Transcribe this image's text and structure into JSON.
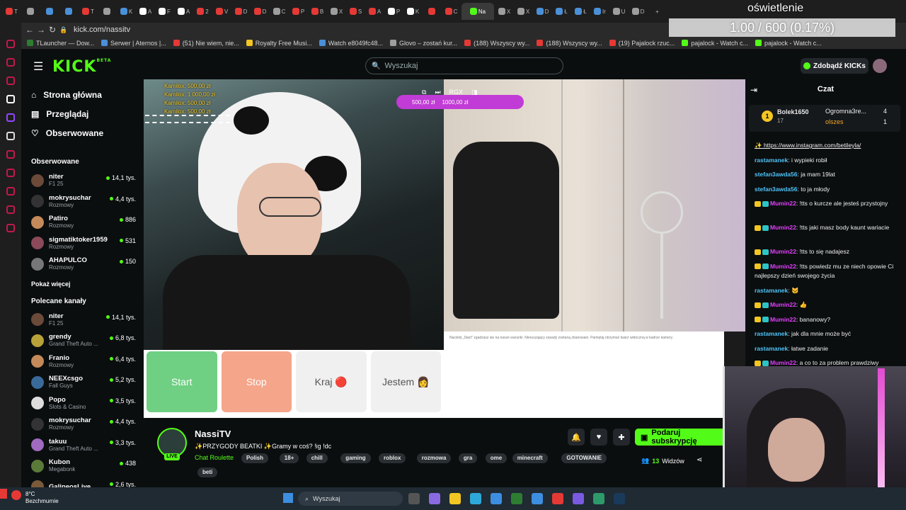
{
  "browser": {
    "tabs": [
      {
        "label": "T",
        "color": "#e53935"
      },
      {
        "label": "",
        "color": "#9e9e9e"
      },
      {
        "label": "",
        "color": "#4a90d9"
      },
      {
        "label": "",
        "color": "#4a90d9"
      },
      {
        "label": "T",
        "color": "#e53935"
      },
      {
        "label": "",
        "color": "#9e9e9e"
      },
      {
        "label": "K",
        "color": "#4a90d9"
      },
      {
        "label": "A",
        "color": "#fff"
      },
      {
        "label": "F",
        "color": "#fff"
      },
      {
        "label": "A",
        "color": "#fff"
      },
      {
        "label": "2",
        "color": "#e53935"
      },
      {
        "label": "V",
        "color": "#e53935"
      },
      {
        "label": "D",
        "color": "#e53935"
      },
      {
        "label": "D",
        "color": "#e53935"
      },
      {
        "label": "C",
        "color": "#9e9e9e"
      },
      {
        "label": "P",
        "color": "#e53935"
      },
      {
        "label": "B",
        "color": "#e53935"
      },
      {
        "label": "X",
        "color": "#9e9e9e"
      },
      {
        "label": "S",
        "color": "#e53935"
      },
      {
        "label": "A",
        "color": "#e53935"
      },
      {
        "label": "P",
        "color": "#fff"
      },
      {
        "label": "K",
        "color": "#fff"
      },
      {
        "label": "",
        "color": "#e53935"
      },
      {
        "label": "C",
        "color": "#e53935"
      },
      {
        "label": "Na",
        "color": "#53fc18",
        "active": true
      },
      {
        "label": "X",
        "color": "#9e9e9e"
      },
      {
        "label": "X",
        "color": "#9e9e9e"
      },
      {
        "label": "D",
        "color": "#4a90d9"
      },
      {
        "label": "Ł",
        "color": "#4a90d9"
      },
      {
        "label": "Ł",
        "color": "#4a90d9"
      },
      {
        "label": "Ir",
        "color": "#4a90d9"
      },
      {
        "label": "U",
        "color": "#9e9e9e"
      },
      {
        "label": "D",
        "color": "#9e9e9e"
      }
    ],
    "url": "kick.com/nassitv",
    "bookmarks": [
      {
        "label": "TLauncher — Dow...",
        "color": "#2e7d32"
      },
      {
        "label": "Serwer | Aternos |...",
        "color": "#4a90d9"
      },
      {
        "label": "(51) Nie wiem, nie...",
        "color": "#e53935"
      },
      {
        "label": "Royalty Free Musi...",
        "color": "#f3c623"
      },
      {
        "label": "Watch e8049fc48...",
        "color": "#4a90d9"
      },
      {
        "label": "Glovo – zostań kur...",
        "color": "#9e9e9e"
      },
      {
        "label": "(188) Wszyscy wy...",
        "color": "#e53935"
      },
      {
        "label": "(188) Wszyscy wy...",
        "color": "#e53935"
      },
      {
        "label": "(19) Pajalock rzuc...",
        "color": "#e53935"
      },
      {
        "label": "pajalock - Watch c...",
        "color": "#53fc18"
      },
      {
        "label": "pajalock - Watch c...",
        "color": "#53fc18"
      }
    ]
  },
  "header": {
    "logo": "KICK",
    "logo_sup": "BETA",
    "search_placeholder": "Wyszukaj",
    "get_kicks": "Zdobądź KICKs"
  },
  "sidebar": {
    "nav": [
      {
        "label": "Strona główna",
        "icon": "home-icon"
      },
      {
        "label": "Przeglądaj",
        "icon": "browse-icon"
      },
      {
        "label": "Obserwowane",
        "icon": "heart-icon"
      }
    ],
    "following_title": "Obserwowane",
    "following": [
      {
        "name": "niter",
        "category": "F1 25",
        "viewers": "14,1 tys.",
        "color": "#6b4a3a"
      },
      {
        "name": "mokrysuchar",
        "category": "Rozmowy",
        "viewers": "4,4 tys.",
        "color": "#333"
      },
      {
        "name": "Patiro",
        "category": "Rozmowy",
        "viewers": "886",
        "color": "#c48a5a"
      },
      {
        "name": "sigmatiktoker1959",
        "category": "Rozmowy",
        "viewers": "531",
        "color": "#8a4a5a"
      },
      {
        "name": "AHAPULCO",
        "category": "Rozmowy",
        "viewers": "150",
        "color": "#777"
      }
    ],
    "show_more": "Pokaż więcej",
    "recommended_title": "Polecane kanały",
    "recommended": [
      {
        "name": "niter",
        "category": "F1 25",
        "viewers": "14,1 tys.",
        "color": "#6b4a3a"
      },
      {
        "name": "grendy",
        "category": "Grand Theft Auto ...",
        "viewers": "6,8 tys.",
        "color": "#b8a23a"
      },
      {
        "name": "Franio",
        "category": "Rozmowy",
        "viewers": "6,4 tys.",
        "color": "#c48a5a"
      },
      {
        "name": "NEEXcsgo",
        "category": "Fall Guys",
        "viewers": "5,2 tys.",
        "color": "#3a6a9a"
      },
      {
        "name": "Popo",
        "category": "Slots & Casino",
        "viewers": "3,5 tys.",
        "color": "#ddd"
      },
      {
        "name": "mokrysuchar",
        "category": "Rozmowy",
        "viewers": "4,4 tys.",
        "color": "#333"
      },
      {
        "name": "takuu",
        "category": "Grand Theft Auto ...",
        "viewers": "3,3 tys.",
        "color": "#a06ac0"
      },
      {
        "name": "Kubon",
        "category": "Megabonk",
        "viewers": "438",
        "color": "#5a7a3a"
      },
      {
        "name": "GalineosLive",
        "category": "",
        "viewers": "2,6 tys.",
        "color": "#7a5a3a"
      }
    ]
  },
  "stream": {
    "donations": [
      "Kamilox: 500,00 zł",
      "Kamilox: 1 000,00 zł",
      "Kamilox: 500,00 zł",
      "Kamilox: 500,00 zł"
    ],
    "overlay_amounts": [
      "500,00 zł",
      "1000,00 zł"
    ],
    "game_buttons": [
      {
        "label": "Start",
        "bg": "#6fcf83",
        "fg": "#ffffff"
      },
      {
        "label": "Stop",
        "bg": "#f4a58a",
        "fg": "#ffffff"
      },
      {
        "label": "Kraj 🔴",
        "bg": "#f0f0f0",
        "fg": "#555555"
      },
      {
        "label": "Jestem 👩",
        "bg": "#f0f0f0",
        "fg": "#555555"
      }
    ],
    "chat_note": "Naciśnij „Start\" zgadzasz się na nasze warunki. Nieruszający zasady zostaną zbanowani. Pamiętaj otrzymać twarz widoczną w kadrze kamery."
  },
  "channel": {
    "name": "NassiTV",
    "live": "LIVE",
    "title": "✨PRZYGODY BEATKI ✨Gramy w coś? !ig !dc",
    "category": "Chat Roulette",
    "tags": [
      "Polish",
      "18+",
      "chill",
      "gaming",
      "roblox",
      "rozmowa",
      "gra",
      "ome",
      "minecraft",
      "GOTOWANIE",
      "beti"
    ],
    "subscribe": "Podaruj subskrypcję",
    "viewers_count": "13",
    "viewers_label": "Widzów"
  },
  "chat": {
    "title": "Czat",
    "leaderboard": [
      {
        "rank": "1",
        "name": "Bolek1650",
        "count": "17"
      },
      {
        "name": "Ogromna3re...",
        "count": "4"
      },
      {
        "name": "olszes",
        "count": "1"
      }
    ],
    "messages": [
      {
        "user": "",
        "text": "✨ https://www.instagram.com/betileyla/",
        "color": "#ffffff",
        "link": true
      },
      {
        "user": "rastamanek",
        "text": ": i wypieki robił",
        "color": "#4fc3f7"
      },
      {
        "user": "stefan3awda56",
        "text": ": ja mam 19lat",
        "color": "#4fc3f7"
      },
      {
        "user": "stefan3awda56",
        "text": ": to ja młody",
        "color": "#4fc3f7"
      },
      {
        "user": "Mumin22",
        "text": ": !tts o kurcze ale jesteś przystojny",
        "color": "#e040fb",
        "badges": true
      },
      {
        "user": "Mumin22",
        "text": ": !tts jaki masz body kaunt wariacie",
        "color": "#e040fb",
        "badges": true
      },
      {
        "user": "Mumin22",
        "text": ": !tts to się nadajesz",
        "color": "#e040fb",
        "badges": true
      },
      {
        "user": "Mumin22",
        "text": ": !tts powiedz mu ze niech opowie Ci najlepszy dzień swojego życia",
        "color": "#e040fb",
        "badges": true
      },
      {
        "user": "rastamanek",
        "text": ": 🐱",
        "color": "#4fc3f7"
      },
      {
        "user": "Mumin22",
        "text": ": 👍",
        "color": "#e040fb",
        "badges": true
      },
      {
        "user": "Mumin22",
        "text": ": bananowy?",
        "color": "#e040fb",
        "badges": true
      },
      {
        "user": "rastamanek",
        "text": ": jak dla mnie może być",
        "color": "#4fc3f7"
      },
      {
        "user": "rastamanek",
        "text": ": łatwe zadanie",
        "color": "#4fc3f7"
      },
      {
        "user": "Mumin22",
        "text": ": a co to za problem prawdziwy",
        "color": "#e040fb",
        "badges": true
      }
    ]
  },
  "obs": {
    "title": "oświetlenie",
    "counter": "1.00 / 600 (0.17%)"
  },
  "taskbar": {
    "temperature": "8°C",
    "weather": "Bezchmurnie",
    "search": "Wyszukaj",
    "apps": [
      {
        "name": "start-icon",
        "color": "#3d8ee0"
      },
      {
        "name": "explorer-icon",
        "color": "#555"
      },
      {
        "name": "copilot-icon",
        "color": "#8a6ae0"
      },
      {
        "name": "folder-icon",
        "color": "#f3c623"
      },
      {
        "name": "edge-icon",
        "color": "#2ea8d8"
      },
      {
        "name": "store-icon",
        "color": "#3d8ee0"
      },
      {
        "name": "xbox-icon",
        "color": "#2e7d32"
      },
      {
        "name": "vscode-icon",
        "color": "#3d8ee0"
      },
      {
        "name": "opera-icon",
        "color": "#e53935"
      },
      {
        "name": "discord-icon",
        "color": "#7a5ae0"
      },
      {
        "name": "app-icon",
        "color": "#2e9a6a"
      },
      {
        "name": "steam-icon",
        "color": "#1a3a5a"
      }
    ]
  }
}
